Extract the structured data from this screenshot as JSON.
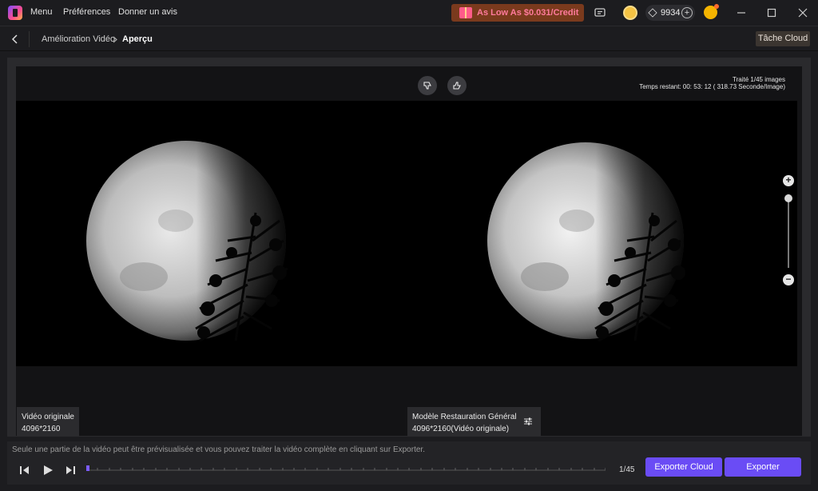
{
  "titlebar": {
    "menu": [
      "Menu",
      "Préférences",
      "Donner un avis"
    ],
    "promo": "As Low As $0.031/Credit",
    "credits": "9934",
    "promo_color": "#ff7a9c"
  },
  "breadcrumb": {
    "parent": "Amélioration Vidéo",
    "current": "Aperçu"
  },
  "cloud_task": "Tâche Cloud",
  "preview": {
    "progress_line1": "Traité 1/45 images",
    "progress_line2": "Temps restant: 00: 53: 12 ( 318.73 Seconde/Image)",
    "left_label_title": "Vidéo originale",
    "left_label_res": "4096*2160",
    "right_label_title": "Modèle Restauration Général",
    "right_label_res": "4096*2160(Vidéo originale)"
  },
  "footer": {
    "hint": "Seule une partie de la vidéo peut être prévisualisée et vous pouvez traiter la vidéo complète en cliquant sur Exporter.",
    "frame": "1/45",
    "export_cloud": "Exporter Cloud",
    "export": "Exporter",
    "accent": "#6a4cf5"
  }
}
